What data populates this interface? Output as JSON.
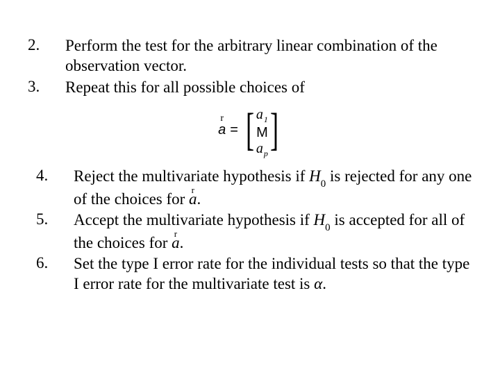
{
  "list1": {
    "items": [
      {
        "num": "2.",
        "text": "Perform the test for the arbitrary linear combination of the observation vector."
      },
      {
        "num": "3.",
        "text": "Repeat this for all possible choices of"
      }
    ]
  },
  "formula": {
    "a_label": "a",
    "arrow": "r",
    "eq": "=",
    "top": "a",
    "top_sub": "1",
    "mid": "M",
    "bot": "a",
    "bot_sub": "p"
  },
  "list2": {
    "items": [
      {
        "num": "4.",
        "pre": "Reject the multivariate hypothesis if ",
        "H": "H",
        "Hsub": "0",
        "mid": " is rejected for any one of the choices for ",
        "avec": "a",
        "post": "."
      },
      {
        "num": "5.",
        "pre": "Accept the multivariate hypothesis if ",
        "H": "H",
        "Hsub": "0",
        "mid": " is accepted for all of the choices for ",
        "avec": "a",
        "post": "."
      },
      {
        "num": "6.",
        "pre": "Set the type I error rate for the individual tests so that the type I error rate for the multivariate test is ",
        "alpha": "α",
        "post": "."
      }
    ]
  }
}
